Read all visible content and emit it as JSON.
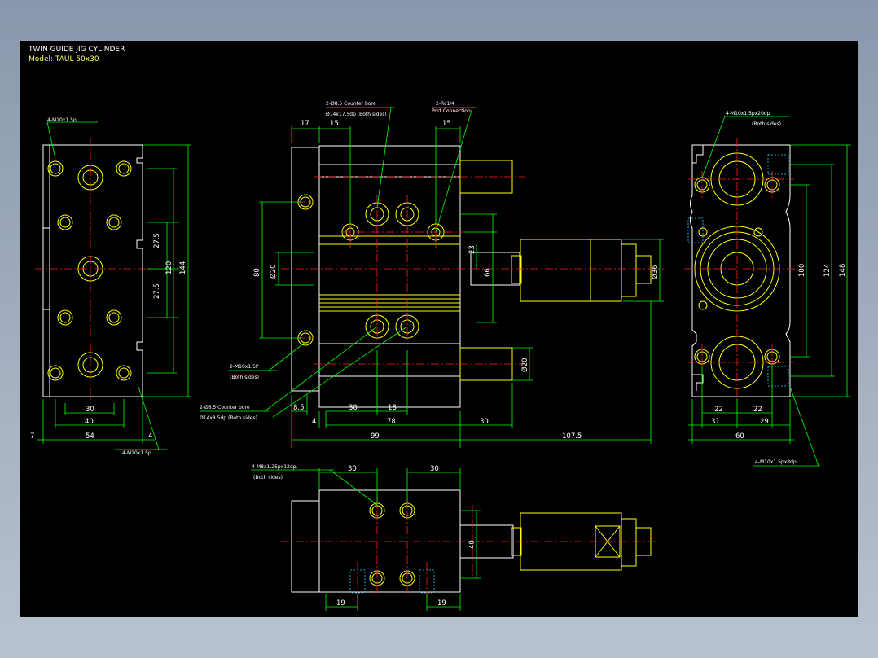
{
  "title": {
    "line1": "TWIN GUIDE JIG CYLINDER",
    "line2": "Model: TAUL 50x30"
  },
  "callouts": {
    "left_top_tap": "4-M10x1.5p",
    "left_bottom_tap": "4-M10x1.5p",
    "counterbore_top_1": "2-Ø8.5 Counter bore",
    "counterbore_top_2": "Ø14x17.5dp (Both sides)",
    "port_1": "2-Rc1/4",
    "port_2": "Port Connection",
    "front_tap_1": "2-M10x1.5P",
    "front_tap_2": "(Both sides)",
    "counterbore_bot_1": "2-Ø8.5 Counter bore",
    "counterbore_bot_2": "Ø14x8.5dp (Both sides)",
    "right_top_tap_1": "4-M10x1.5px20dp",
    "right_top_tap_2": "(Both sides)",
    "right_bottom_tap": "4-M10x1.5px8dp.",
    "bottom_tap_1": "4-M8x1.25px12dp.",
    "bottom_tap_2": "(Both sides)"
  },
  "dimensions": {
    "left_view": [
      "27.5",
      "27.5",
      "120",
      "144",
      "30",
      "40",
      "54",
      "7",
      "4"
    ],
    "front_view": [
      "17",
      "15",
      "15",
      "80",
      "Ø20",
      "23",
      "66",
      "Ø36",
      "Ø20",
      "8.5",
      "4",
      "30",
      "18",
      "78",
      "30",
      "99",
      "107.5"
    ],
    "right_view": [
      "100",
      "124",
      "148",
      "22",
      "22",
      "31",
      "29",
      "60"
    ],
    "bottom_view": [
      "30",
      "30",
      "40",
      "19",
      "19"
    ]
  },
  "colors": {
    "background": "#000000",
    "outline": "#ffff00",
    "dimension": "#00ff00",
    "centerline": "#ff2020",
    "hidden": "#33ccff",
    "text": "#ffffff"
  }
}
